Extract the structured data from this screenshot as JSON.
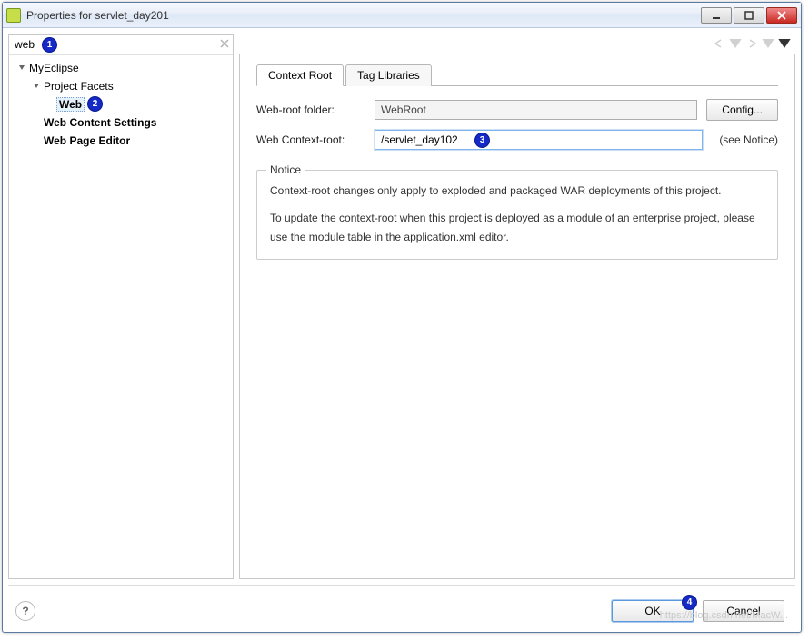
{
  "window": {
    "title": "Properties for servlet_day201"
  },
  "search": {
    "value": "web"
  },
  "tree": {
    "root": "MyEclipse",
    "project_facets": "Project Facets",
    "web": "Web",
    "web_content_settings": "Web Content Settings",
    "web_page_editor": "Web Page Editor"
  },
  "tabs": {
    "context_root": "Context Root",
    "tag_libraries": "Tag Libraries"
  },
  "form": {
    "web_root_label": "Web-root folder:",
    "web_root_value": "WebRoot",
    "context_root_label": "Web Context-root:",
    "context_root_value": "/servlet_day102",
    "config_btn": "Config...",
    "see_notice": "(see Notice)"
  },
  "notice": {
    "legend": "Notice",
    "line1": "Context-root changes only apply to exploded and packaged WAR deployments of this project.",
    "line2": "To update the context-root when this project is deployed as a module of an enterprise project, please use the module table in the application.xml editor."
  },
  "buttons": {
    "ok": "OK",
    "cancel": "Cancel"
  },
  "badges": {
    "b1": "1",
    "b2": "2",
    "b3": "3",
    "b4": "4"
  },
  "watermark": "https://blog.csdn.net/MacW..."
}
